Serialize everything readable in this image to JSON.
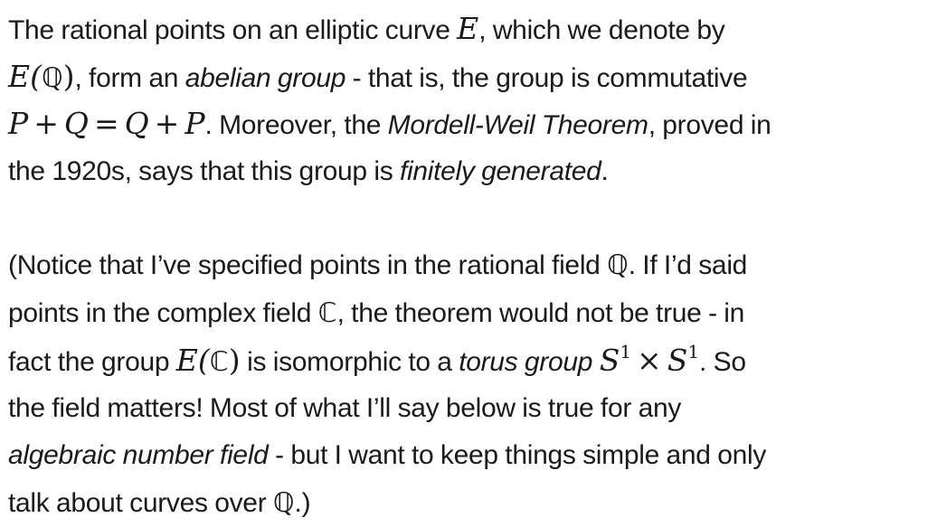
{
  "paragraph1": {
    "line1": {
      "t1": "The rational points on an elliptic curve ",
      "m1": "E",
      "t2": ", which we denote by"
    },
    "line2": {
      "m1": "E(",
      "bb1": "ℚ",
      "m2": ")",
      "t1": ", form an ",
      "em1": "abelian group",
      "t2": " - that is, the group is commutative"
    },
    "line3": {
      "m_p": "P",
      "op_plus1": "+",
      "m_q": "Q",
      "op_eq": "=",
      "m_q2": "Q",
      "op_plus2": "+",
      "m_p2": "P",
      "t1": ". Moreover, the ",
      "em1": "Mordell-Weil Theorem",
      "t2": ", proved in"
    },
    "line4": {
      "t1": "the 1920s, says that this group is ",
      "em1": "finitely generated",
      "t2": "."
    }
  },
  "paragraph2": {
    "line1": {
      "t1": "(Notice that I’ve specified points in the rational field ",
      "bb1": "ℚ",
      "t2": ". If I’d said"
    },
    "line2": {
      "t1": "points in the complex field ",
      "bb1": "ℂ",
      "t2": ", the theorem would not be true - in"
    },
    "line3": {
      "t1": "fact the group ",
      "m1": "E(",
      "bb1": "ℂ",
      "m2": ")",
      "t2": " is isomorphic to a ",
      "em1": "torus group",
      "m_s1": "S",
      "sup1": "1",
      "op_times": "×",
      "m_s2": "S",
      "sup2": "1",
      "t3": ". So"
    },
    "line4": {
      "t1": "the field matters! Most of what I’ll say below is true for any"
    },
    "line5": {
      "em1": "algebraic number field",
      "t1": " - but I want to keep things simple and only"
    },
    "line6": {
      "t1": "talk about curves over ",
      "bb1": "ℚ",
      "t2": ".)"
    }
  }
}
